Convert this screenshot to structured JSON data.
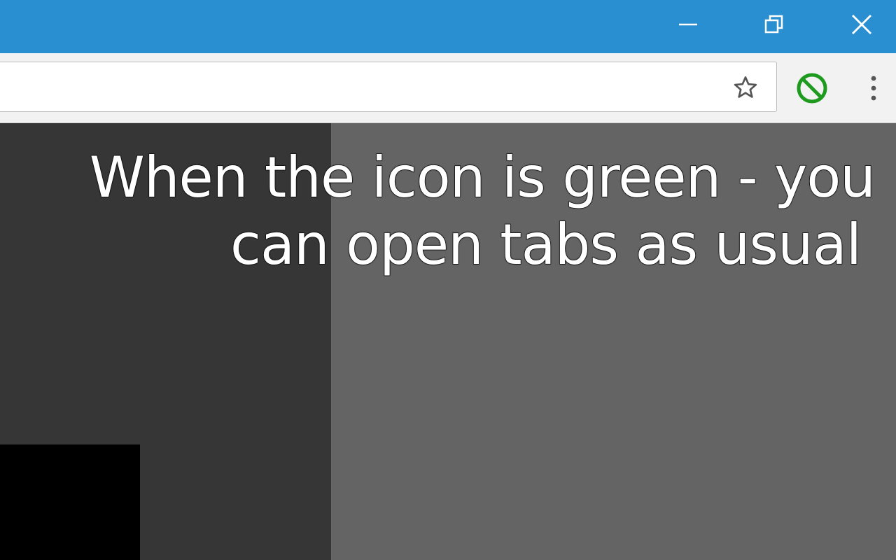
{
  "window": {
    "title_bar_color": "#2a8fd0",
    "controls": {
      "minimize_icon": "minimize-icon",
      "restore_icon": "restore-icon",
      "close_icon": "close-icon"
    }
  },
  "toolbar": {
    "address_value": "",
    "bookmark_icon": "star-icon",
    "extension_icon": "blocked-icon",
    "extension_color": "#1e9a1e",
    "menu_icon": "more-vertical-icon"
  },
  "content": {
    "caption_line1": "When the icon is green - you",
    "caption_line2": "can open tabs as usual"
  }
}
